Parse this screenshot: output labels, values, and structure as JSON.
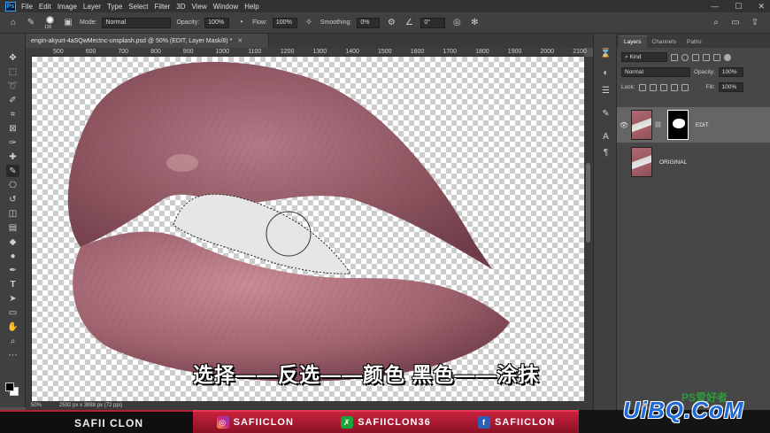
{
  "app": {
    "logo": "Ps",
    "menu": [
      "File",
      "Edit",
      "Image",
      "Layer",
      "Type",
      "Select",
      "Filter",
      "3D",
      "View",
      "Window",
      "Help"
    ]
  },
  "options": {
    "brush_size": "136",
    "mode_label": "Mode:",
    "mode_value": "Normal",
    "opacity_label": "Opacity:",
    "opacity_value": "100%",
    "flow_label": "Flow:",
    "flow_value": "100%",
    "smoothing_label": "Smoothing:",
    "smoothing_value": "0%",
    "angle_value": "0°"
  },
  "document": {
    "tab_title": "engin-akyurt-4aSQwMectnc-unsplash.psd @ 50% (EDIT, Layer Mask/8) *",
    "zoom": "50%",
    "size_info": "2592 px x 3888 px (72 ppi)"
  },
  "ruler": {
    "ticks": [
      "500",
      "600",
      "700",
      "800",
      "900",
      "1000",
      "1100",
      "1200",
      "1300",
      "1400",
      "1500",
      "1600",
      "1700",
      "1800",
      "1900",
      "2000",
      "2100"
    ]
  },
  "subtitle": "选择——反选——颜色 黑色——涂抹",
  "layers_panel": {
    "tabs": [
      "Layers",
      "Channels",
      "Paths"
    ],
    "kind_filter": "Kind",
    "blend_mode": "Normal",
    "opacity_label": "Opacity:",
    "opacity_value": "100%",
    "lock_label": "Lock:",
    "fill_label": "Fill:",
    "fill_value": "100%",
    "layers": [
      {
        "name": "EDIT",
        "selected": true
      },
      {
        "name": "ORIGINAL",
        "selected": false
      }
    ]
  },
  "banner": {
    "channel": "SAFII CLON",
    "instagram": "SAFIICLON",
    "xbox": "SAFIICLON36",
    "facebook": "SAFIICLON"
  },
  "watermark": {
    "site": "UiBQ.CoM",
    "small": "PS爱好者"
  }
}
